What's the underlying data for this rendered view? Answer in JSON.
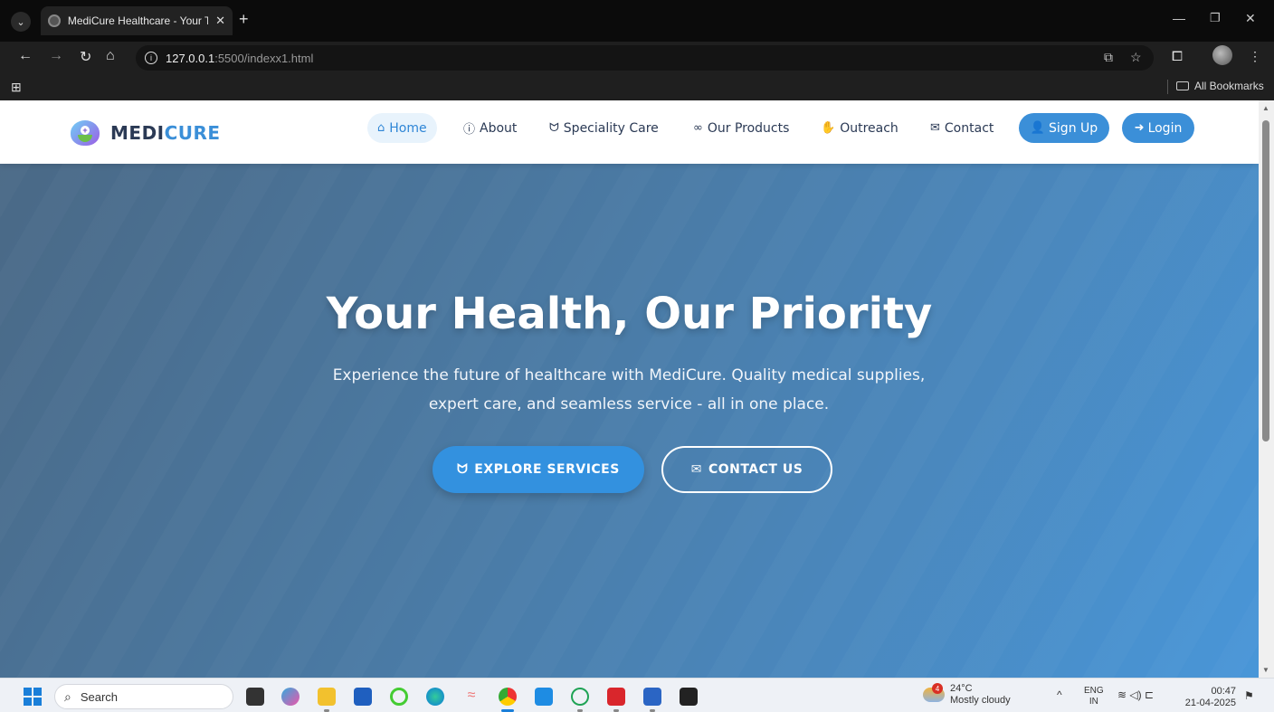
{
  "browser": {
    "tab_title": "MediCure Healthcare - Your Tru",
    "url_host": "127.0.0.1",
    "url_path": ":5500/indexx1.html",
    "bookmarks_label": "All Bookmarks"
  },
  "site": {
    "brand_part1": "MEDI",
    "brand_part2": "CURE",
    "nav": {
      "home": "Home",
      "about": "About",
      "speciality": "Speciality Care",
      "products": "Our Products",
      "outreach": "Outreach",
      "contact": "Contact",
      "signup": "Sign Up",
      "login": "Login"
    },
    "hero": {
      "title": "Your Health, Our Priority",
      "subtitle": "Experience the future of healthcare with MediCure. Quality medical supplies, expert care, and seamless service - all in one place.",
      "explore_label": "EXPLORE SERVICES",
      "contact_label": "CONTACT US"
    },
    "colors": {
      "primary": "#3b8fd8",
      "dark": "#2b3a55"
    }
  },
  "taskbar": {
    "search_placeholder": "Search",
    "weather_badge": "4",
    "weather_temp": "24°C",
    "weather_desc": "Mostly cloudy",
    "lang_top": "ENG",
    "lang_bottom": "IN",
    "time": "00:47",
    "date": "21-04-2025"
  }
}
